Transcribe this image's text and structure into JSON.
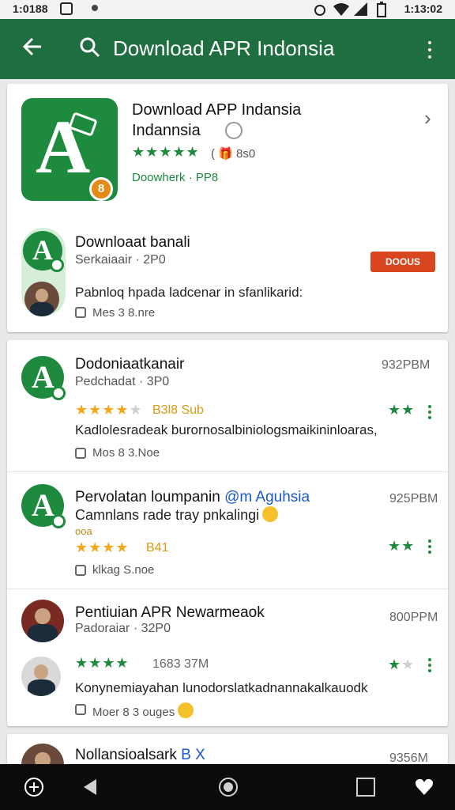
{
  "status_bar": {
    "time_left": "1:0188",
    "time_right": "1:13:02"
  },
  "app_bar": {
    "title": "Download APR Indonsia"
  },
  "featured": {
    "app_name": "Download APP Indansia",
    "app_name_2": "Indannsia",
    "stars": "★★★★★",
    "rating_meta": "( 🎁 8s0",
    "developer": "Doowherk · PP8",
    "review": {
      "title": "Downloaat banali",
      "subtitle": "Serkaiaair · 2P0",
      "promo": "DOOUS",
      "body": "Pabnloq hpada ladcenar in sfanlikarid:",
      "meta": "Mes 3 8.nre"
    }
  },
  "reviews": [
    {
      "title": "Dodoniaatkanair",
      "subtitle": "Pedchadat · 3P0",
      "time": "932PBM",
      "stars": "★★★★",
      "stars_off": "★",
      "rating_text": "B3l8 Sub",
      "right_stars": "★★",
      "body": "Kadlolesradeak burornosalbiniologsmaikininloaras,",
      "meta": "Mos  8 3.Noe"
    },
    {
      "title": "Pervolatan loumpanin",
      "title_accent": "@m Aguhsia",
      "subtitle": "Camnlans rade tray pnkalingi",
      "extra": "ooa",
      "time": "925PBM",
      "stars": "★★★★",
      "rating_text": "B41",
      "right_stars": "★★",
      "meta": "klkag  S.noe"
    },
    {
      "title": "Pentiuian APR Newarmeaok",
      "subtitle": "Padoraiar · 32P0",
      "time": "800PPM",
      "stars": "★★★★",
      "rating_text": "1683 37M",
      "right_stars": "★",
      "right_stars_off": "★",
      "body": "Konynemiayahan lunodorslatkadnannakalkauodk",
      "meta": "Moer  8 3 ouges"
    },
    {
      "title": "Nollansioalsark",
      "title_accent": "B X",
      "time": "9356M"
    }
  ],
  "colors": {
    "app_bar": "#1f6e3f",
    "star_green": "#1f8a3e",
    "star_orange": "#f4a71b"
  }
}
